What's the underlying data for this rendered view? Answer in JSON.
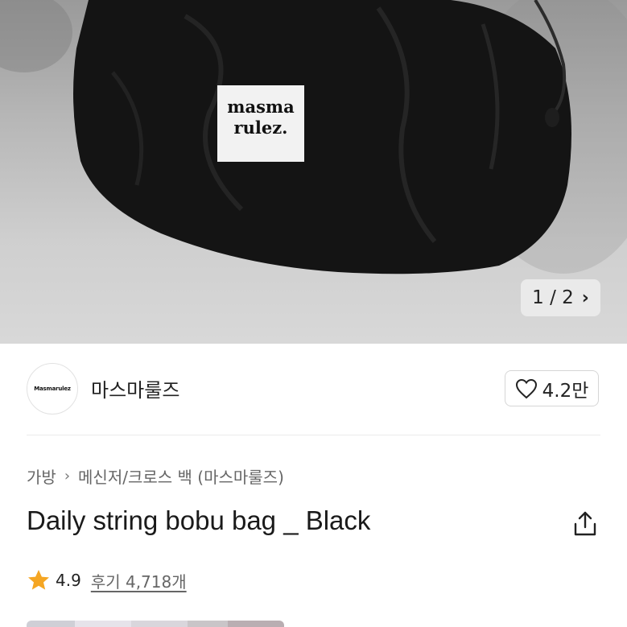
{
  "product_image": {
    "label_line1": "masma",
    "label_line2": "rulez.",
    "counter": "1 / 2"
  },
  "brand": {
    "logo_text": "Masmarulez",
    "name": "마스마룰즈",
    "likes": "4.2만"
  },
  "breadcrumb": {
    "category": "가방",
    "subcategory": "메신저/크로스 백 (마스마룰즈)"
  },
  "product": {
    "title": "Daily string bobu bag _ Black"
  },
  "rating": {
    "score": "4.9",
    "reviews": "후기 4,718개"
  },
  "colors": {
    "star": "#f5a623",
    "bag": "#141414"
  }
}
